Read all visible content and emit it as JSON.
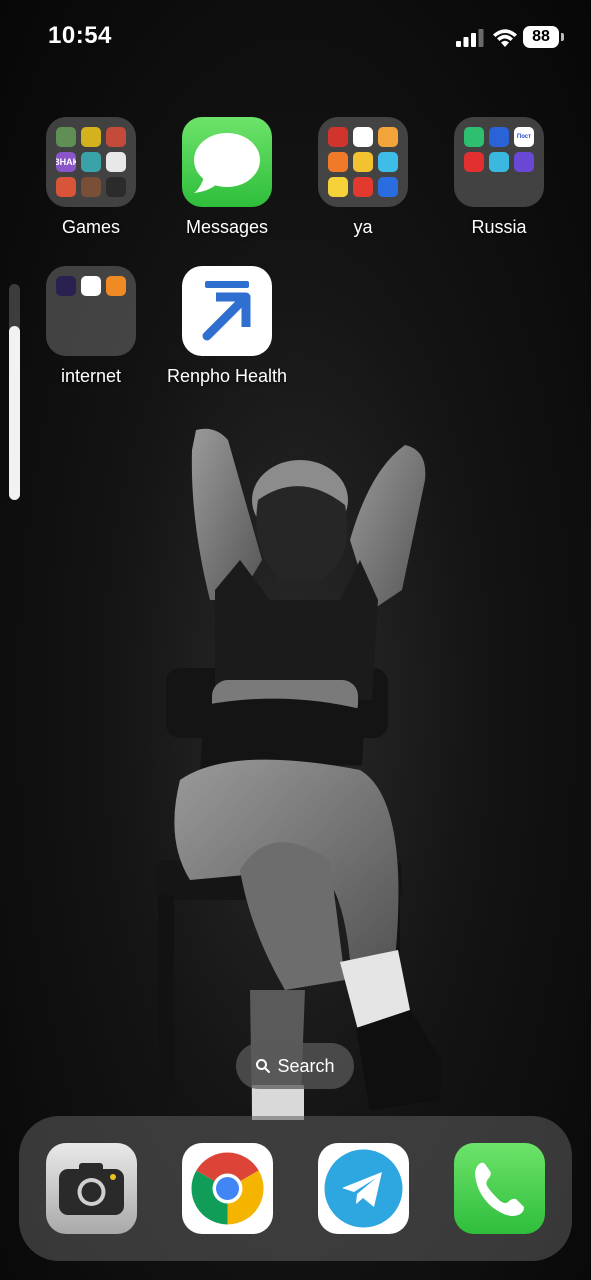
{
  "status_bar": {
    "time": "10:54",
    "battery_level": "88",
    "signal_bars": 3,
    "wifi": true
  },
  "home_screen": {
    "apps": [
      {
        "label": "Games",
        "kind": "folder"
      },
      {
        "label": "Messages",
        "kind": "app",
        "icon": "messages-bubble-icon"
      },
      {
        "label": "ya",
        "kind": "folder"
      },
      {
        "label": "Russia",
        "kind": "folder"
      },
      {
        "label": "internet",
        "kind": "folder"
      },
      {
        "label": "Renpho Health",
        "kind": "app",
        "icon": "renpho-arrow-icon"
      }
    ],
    "folder_thumbnails": {
      "russia": [
        "",
        "",
        "Пост",
        "",
        "",
        ""
      ],
      "games_third_row_first": "ЗНАК"
    },
    "page_scroll_position": 0.2
  },
  "search": {
    "label": "Search",
    "icon": "magnifier-icon"
  },
  "dock": {
    "apps": [
      {
        "name": "Camera",
        "icon": "camera-icon"
      },
      {
        "name": "Chrome",
        "icon": "chrome-logo-icon"
      },
      {
        "name": "Telegram",
        "icon": "telegram-plane-icon"
      },
      {
        "name": "Phone",
        "icon": "phone-handset-icon"
      }
    ]
  },
  "colors": {
    "messages_green": "#34c759",
    "renpho_blue": "#2f6fd0",
    "telegram_blue": "#2ea6e0",
    "phone_green": "#34c759"
  }
}
